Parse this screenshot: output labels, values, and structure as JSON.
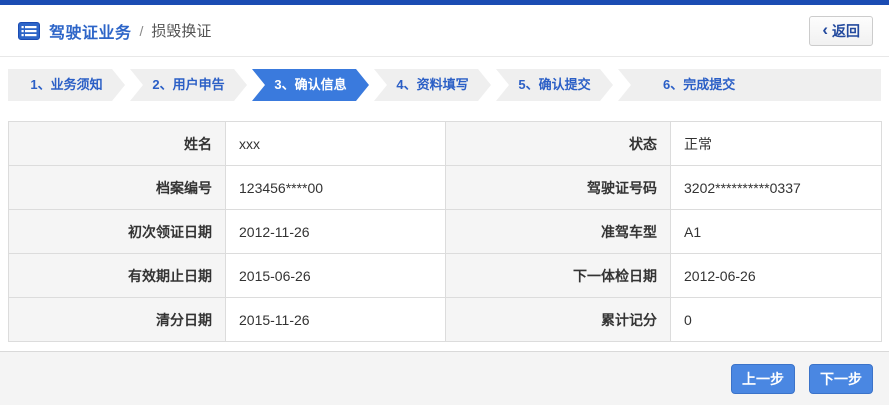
{
  "header": {
    "title": "驾驶证业务",
    "separator": "/",
    "subtitle": "损毁换证",
    "back_chevron": "‹",
    "back_label": "返回"
  },
  "steps": {
    "active_index": 2,
    "items": [
      {
        "label": "1、业务须知"
      },
      {
        "label": "2、用户申告"
      },
      {
        "label": "3、确认信息"
      },
      {
        "label": "4、资料填写"
      },
      {
        "label": "5、确认提交"
      },
      {
        "label": "6、完成提交"
      }
    ]
  },
  "form": {
    "rows": [
      {
        "left": {
          "label": "姓名",
          "value": "xxx"
        },
        "right": {
          "label": "状态",
          "value": "正常"
        }
      },
      {
        "left": {
          "label": "档案编号",
          "value": "123456****00"
        },
        "right": {
          "label": "驾驶证号码",
          "value": "3202**********0337"
        }
      },
      {
        "left": {
          "label": "初次领证日期",
          "value": "2012-11-26"
        },
        "right": {
          "label": "准驾车型",
          "value": "A1"
        }
      },
      {
        "left": {
          "label": "有效期止日期",
          "value": "2015-06-26"
        },
        "right": {
          "label": "下一体检日期",
          "value": "2012-06-26"
        }
      },
      {
        "left": {
          "label": "清分日期",
          "value": "2015-11-26"
        },
        "right": {
          "label": "累计记分",
          "value": "0"
        }
      }
    ]
  },
  "footer": {
    "prev_label": "上一步",
    "next_label": "下一步"
  },
  "colors": {
    "top_bar": "#1b4cb3",
    "title_blue": "#2d65c8",
    "step_text_blue": "#2b5fc6",
    "active_step_bg": "#3a7add",
    "inactive_step_bg": "#efefef",
    "button_blue": "#4a87e2",
    "label_cell_bg": "#f5f5f5",
    "table_border": "#dcdcdc",
    "footer_bg": "#f4f4f4"
  }
}
